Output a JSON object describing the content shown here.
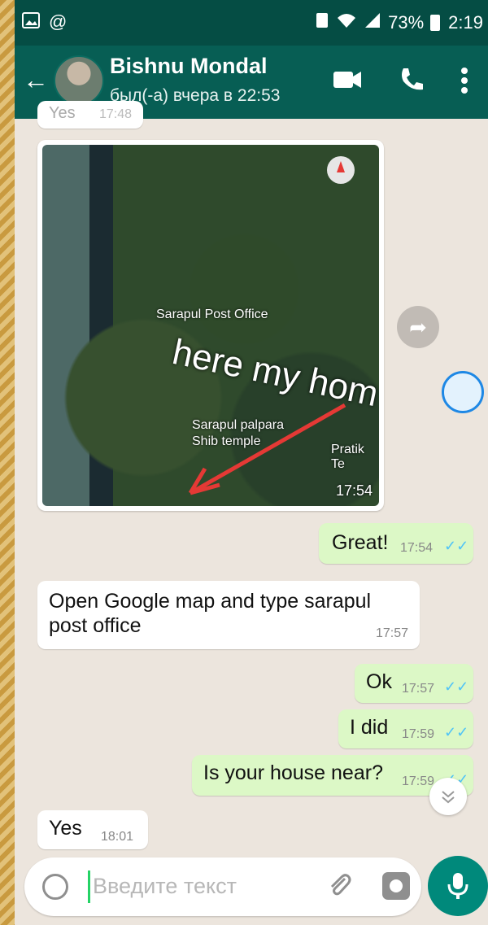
{
  "status": {
    "battery": "73%",
    "clock": "2:19"
  },
  "header": {
    "contact_name": "Bishnu Mondal",
    "last_seen": "был(-а) вчера в 22:53"
  },
  "chat": {
    "image_message": {
      "map_labels": [
        "Sarapul Post Office",
        "Sarapul palpara",
        "Shib temple",
        "Pratik Te"
      ],
      "annotation_text": "here my hom",
      "time": "17:54"
    },
    "messages": [
      {
        "dir": "out",
        "text": "Great!",
        "time": "17:54"
      },
      {
        "dir": "in",
        "text": "Open Google map and type sarapul post office",
        "time": "17:57"
      },
      {
        "dir": "out",
        "text": "Ok",
        "time": "17:57"
      },
      {
        "dir": "out",
        "text": "I did",
        "time": "17:59"
      },
      {
        "dir": "out",
        "text": "Is your house near?",
        "time": "17:59"
      },
      {
        "dir": "in",
        "text": "Yes",
        "time": "18:01"
      }
    ],
    "partial_top": {
      "text": "Yes",
      "time": "17:48"
    }
  },
  "input": {
    "placeholder": "Введите текст"
  },
  "icons": {
    "gallery": "gallery-icon",
    "at": "at-icon",
    "back": "back-arrow-icon",
    "video": "video-call-icon",
    "phone": "phone-icon",
    "menu": "more-vert-icon",
    "forward": "forward-icon",
    "emoji": "emoji-icon",
    "attach": "attach-icon",
    "camera": "camera-icon",
    "mic": "mic-icon",
    "scroll": "scroll-down-icon"
  },
  "colors": {
    "header": "#075e54",
    "statusbar": "#054d44",
    "outgoing": "#dcf8c6",
    "incoming": "#ffffff",
    "tick_read": "#4fc3f7",
    "mic_button": "#00897b"
  }
}
